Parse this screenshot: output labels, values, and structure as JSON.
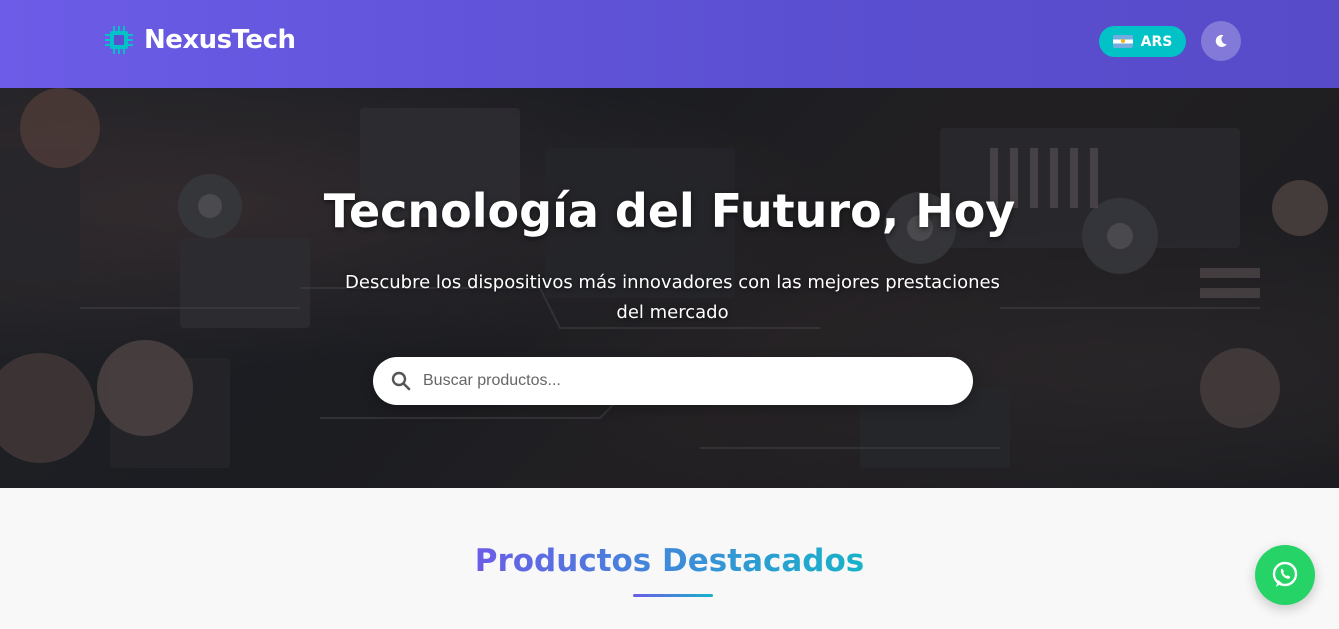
{
  "header": {
    "brand_name": "NexusTech",
    "brand_icon": "chip-icon",
    "currency": {
      "label": "ARS",
      "flag": "argentina-flag-icon"
    },
    "theme_toggle_icon": "moon-icon"
  },
  "hero": {
    "title": "Tecnología del Futuro, Hoy",
    "subtitle": "Descubre los dispositivos más innovadores con las mejores prestaciones del mercado",
    "search": {
      "placeholder": "Buscar productos...",
      "value": ""
    }
  },
  "featured": {
    "title": "Productos Destacados"
  },
  "floating": {
    "whatsapp_icon": "whatsapp-icon"
  },
  "colors": {
    "header_gradient_start": "#6c5ce7",
    "header_gradient_end": "#574bc9",
    "accent_cyan": "#00c2c7",
    "whatsapp_green": "#25d366"
  }
}
